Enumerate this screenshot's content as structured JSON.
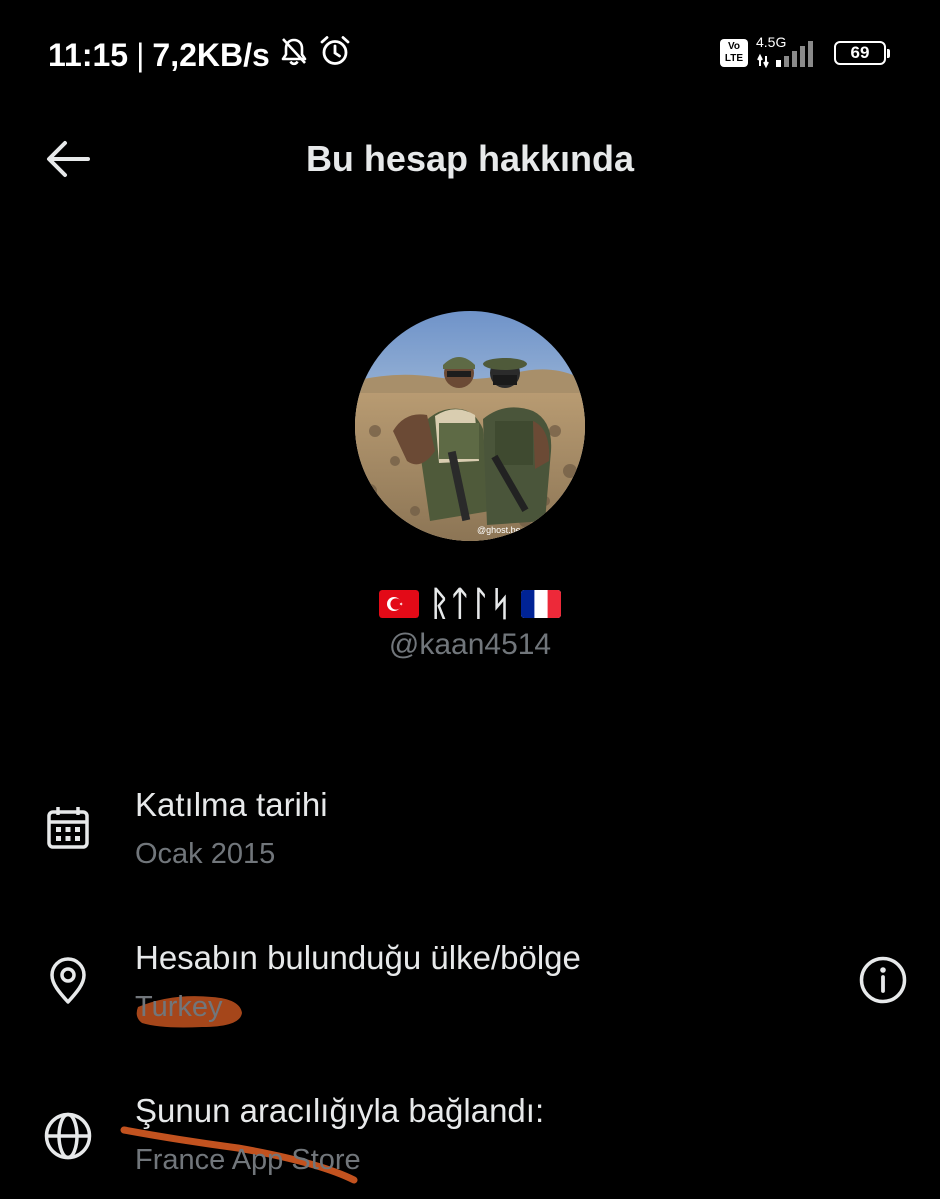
{
  "status_bar": {
    "time": "11:15",
    "separator": "|",
    "speed": "7,2KB/s",
    "volte_top": "Vo",
    "volte_bottom": "LTE",
    "network": "4.5G",
    "battery": "69"
  },
  "header": {
    "title": "Bu hesap hakkında"
  },
  "profile": {
    "display_name": "ᚱᛏᛚᛋ",
    "handle": "@kaan4514",
    "left_flag": "Turkey flag",
    "right_flag": "France flag",
    "avatar_watermark": "@ghost.be"
  },
  "details": {
    "joined": {
      "label": "Katılma tarihi",
      "value": "Ocak 2015",
      "icon": "calendar-icon"
    },
    "country": {
      "label": "Hesabın bulunduğu ülke/bölge",
      "value": "Turkey",
      "icon": "location-pin-icon",
      "help_icon": "info-icon"
    },
    "connected": {
      "label": "Şunun aracılığıyla bağlandı:",
      "value": "France App Store",
      "icon": "globe-icon"
    }
  },
  "colors": {
    "background": "#000000",
    "primary_text": "#e7e9ea",
    "secondary_text": "#71767b",
    "annotation": "#c2521f"
  }
}
